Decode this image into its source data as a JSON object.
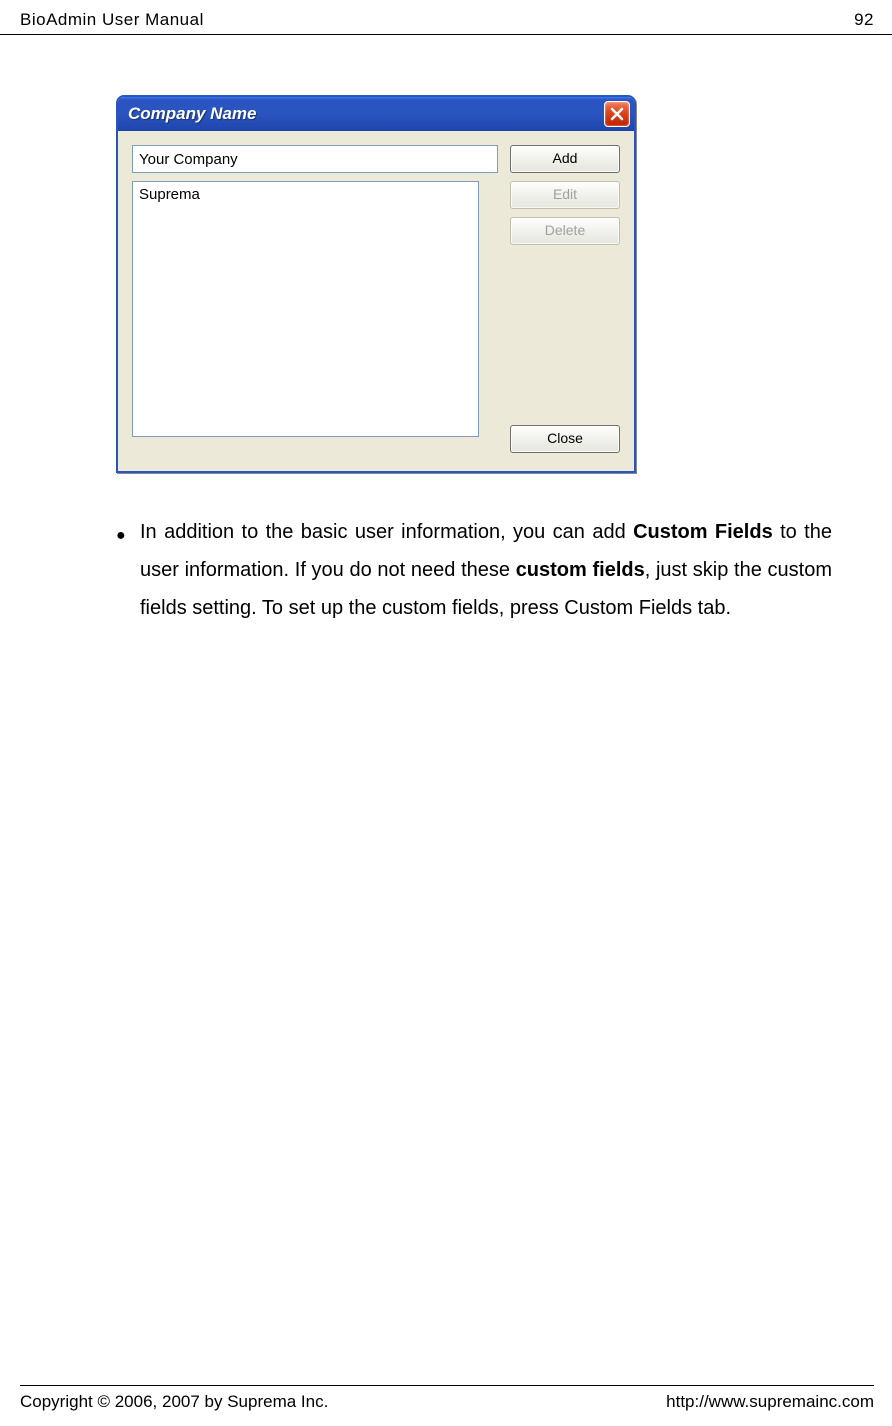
{
  "header": {
    "title": "BioAdmin  User  Manual",
    "page_number": "92"
  },
  "dialog": {
    "title": "Company Name",
    "input_value": "Your Company",
    "list_items": [
      "Suprema"
    ],
    "buttons": {
      "add": "Add",
      "edit": "Edit",
      "delete": "Delete",
      "close": "Close"
    }
  },
  "paragraph": {
    "pre": "In addition to the basic user information, you can add ",
    "bold1": "Custom Fields",
    "mid": " to the user information. If you do not need these ",
    "bold2": "custom fields",
    "post": ", just skip the custom fields setting. To set up the custom fields, press Custom Fields tab."
  },
  "footer": {
    "copyright": "Copyright © 2006, 2007 by Suprema Inc.",
    "url": "http://www.supremainc.com"
  }
}
